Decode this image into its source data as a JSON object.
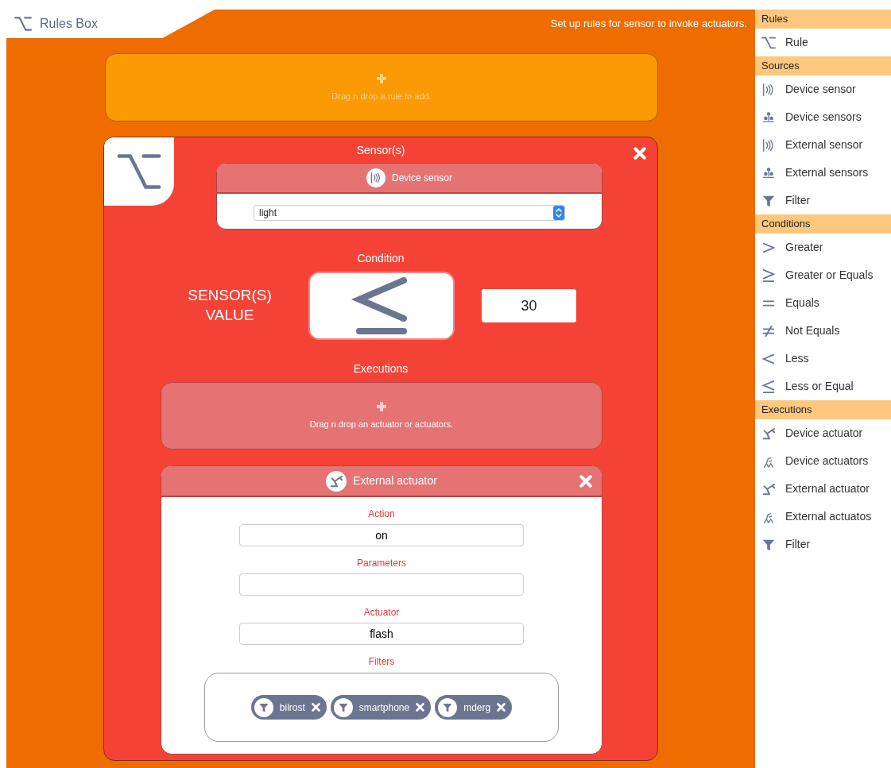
{
  "header": {
    "title": "Rules Box",
    "description": "Set up rules for sensor to invoke actuators."
  },
  "rule_drop_zone": {
    "hint": "Drag n drop a rule to add."
  },
  "rule": {
    "sensors_label": "Sensor(s)",
    "sensor": {
      "title": "Device sensor",
      "select_value": "light"
    },
    "condition_label": "Condition",
    "value_label": "SENSOR(S) VALUE",
    "condition": {
      "kind": "less_or_equal"
    },
    "threshold": "30",
    "executions_label": "Executions",
    "execution_drop_hint": "Drag n drop an actuator or actuators.",
    "actuator": {
      "title": "External actuator",
      "fields": [
        {
          "label": "Action",
          "value": "on"
        },
        {
          "label": "Parameters"
        },
        {
          "label": "Actuator",
          "value": "flash"
        }
      ],
      "filters_label": "Filters",
      "filters": [
        {
          "label": "bilrost"
        },
        {
          "label": "smartphone"
        },
        {
          "label": "mderg"
        }
      ]
    }
  },
  "palette": [
    {
      "heading": "Rules",
      "items": [
        {
          "label": "Rule",
          "kind": "rule"
        }
      ]
    },
    {
      "heading": "Sources",
      "items": [
        {
          "label": "Device sensor",
          "kind": "sensor"
        },
        {
          "label": "Device sensors",
          "kind": "sensors"
        },
        {
          "label": "External sensor",
          "kind": "sensor"
        },
        {
          "label": "External sensors",
          "kind": "sensors"
        },
        {
          "label": "Filter",
          "kind": "filter"
        }
      ]
    },
    {
      "heading": "Conditions",
      "items": [
        {
          "label": "Greater",
          "kind": "greater"
        },
        {
          "label": "Greater or Equals",
          "kind": "greater_or_equal"
        },
        {
          "label": "Equals",
          "kind": "equal"
        },
        {
          "label": "Not Equals",
          "kind": "not_equal"
        },
        {
          "label": "Less",
          "kind": "less"
        },
        {
          "label": "Less or Equal",
          "kind": "less_or_equal"
        }
      ]
    },
    {
      "heading": "Executions",
      "items": [
        {
          "label": "Device actuator",
          "kind": "actuator"
        },
        {
          "label": "Device actuators",
          "kind": "actuators"
        },
        {
          "label": "External actuator",
          "kind": "actuator"
        },
        {
          "label": "External actuatos",
          "kind": "actuators"
        },
        {
          "label": "Filter",
          "kind": "filter"
        }
      ]
    }
  ]
}
